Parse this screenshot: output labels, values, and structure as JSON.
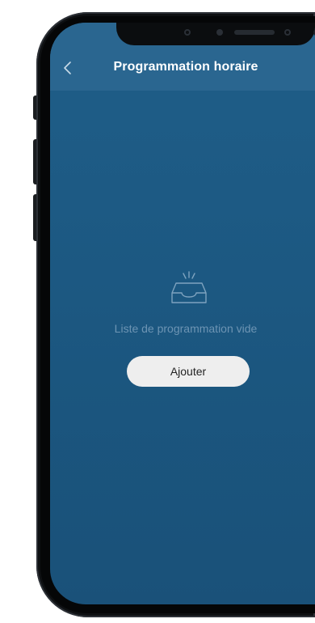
{
  "header": {
    "title": "Programmation horaire",
    "back_icon": "chevron-left-icon"
  },
  "empty_state": {
    "icon": "empty-inbox-icon",
    "message": "Liste de programmation vide",
    "add_label": "Ajouter"
  },
  "colors": {
    "background": "#1d5a84",
    "header_background": "#2a6690",
    "title_text": "#ffffff",
    "empty_text": "#6d94b3",
    "button_background": "#eeeeee",
    "button_text": "#222222"
  }
}
